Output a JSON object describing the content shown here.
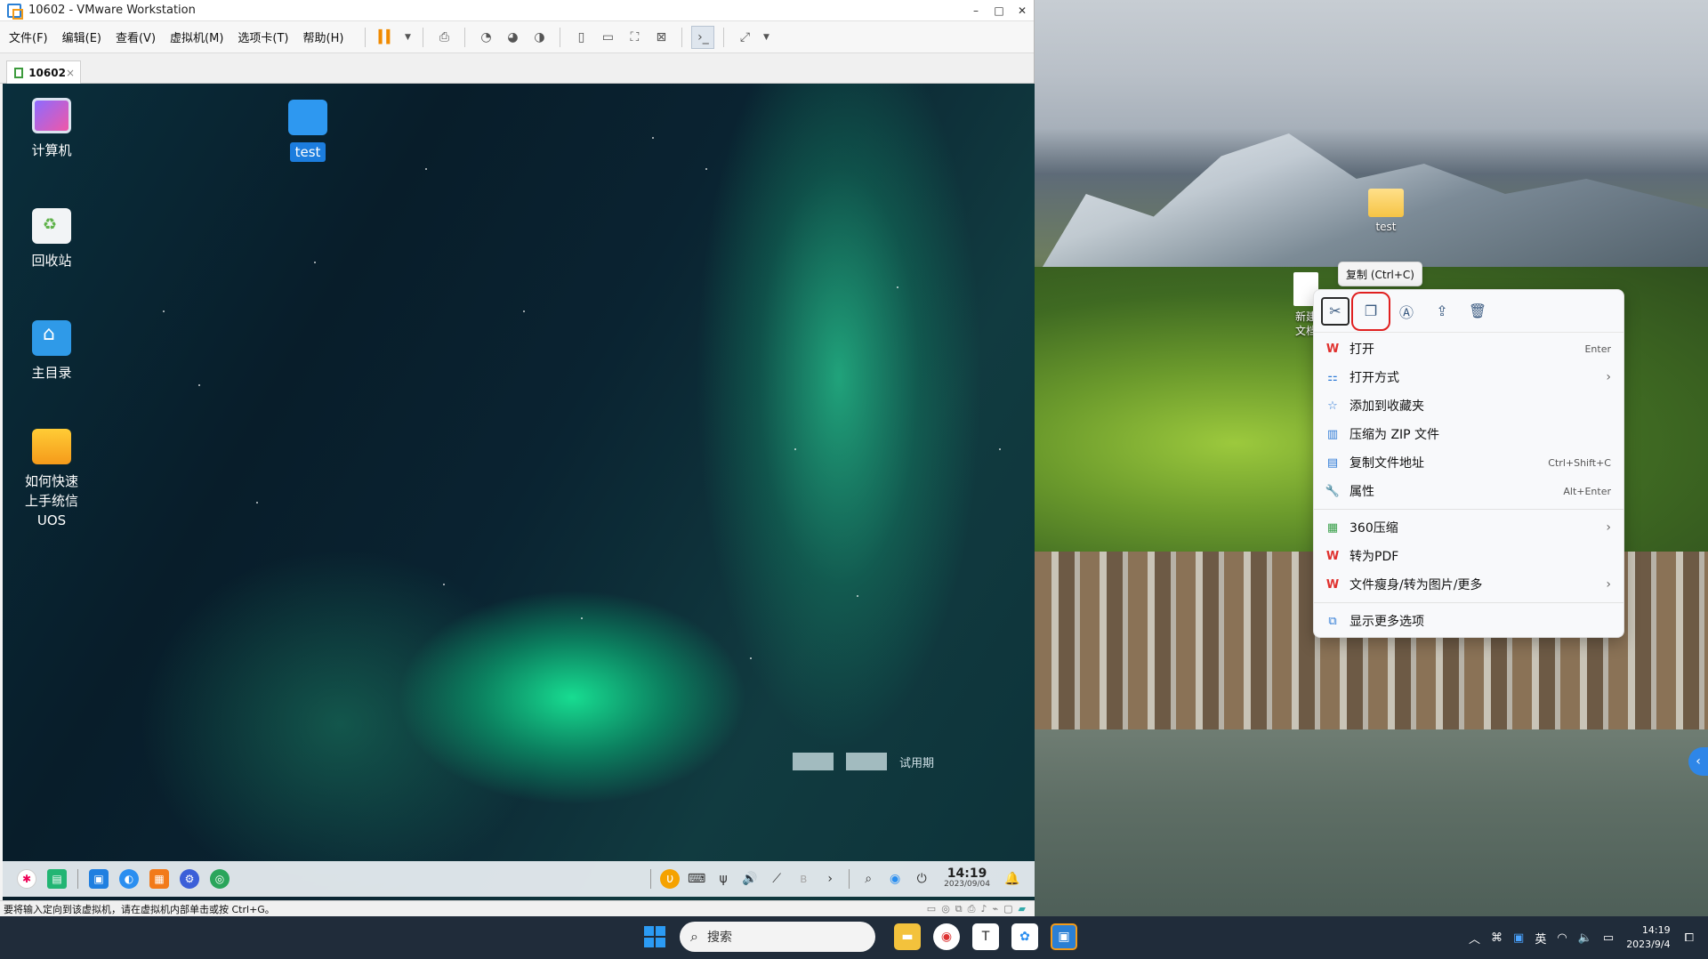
{
  "vm_window": {
    "title": "10602 - VMware Workstation",
    "window_controls": {
      "minimize": "–",
      "maximize": "□",
      "close": "✕"
    },
    "menu": [
      "文件(F)",
      "编辑(E)",
      "查看(V)",
      "虚拟机(M)",
      "选项卡(T)",
      "帮助(H)"
    ],
    "tab": {
      "label": "10602",
      "close": "×"
    },
    "status_text": "要将输入定向到该虚拟机，请在虚拟机内部单击或按 Ctrl+G。"
  },
  "guest": {
    "desktop_icons": [
      {
        "label": "计算机",
        "icon": "computer-icon"
      },
      {
        "label": "回收站",
        "icon": "trash-icon"
      },
      {
        "label": "主目录",
        "icon": "home-folder-icon"
      },
      {
        "label": "如何快速上手统信UOS",
        "icon": "uos-guide-icon"
      },
      {
        "label": "test",
        "icon": "folder-icon",
        "selected": true
      }
    ],
    "trial_text": "试用期",
    "taskbar": {
      "clock_time": "14:19",
      "clock_date": "2023/09/04"
    }
  },
  "host": {
    "desktop_icons": [
      {
        "label": "test",
        "icon": "folder-icon"
      },
      {
        "label": "新建文档",
        "icon": "document-icon"
      }
    ],
    "tooltip": "复制 (Ctrl+C)",
    "context_menu": {
      "toolbar": [
        {
          "name": "cut",
          "icon": "cut-icon",
          "glyph": "✂"
        },
        {
          "name": "copy",
          "icon": "copy-icon",
          "glyph": "❐"
        },
        {
          "name": "rename",
          "icon": "rename-icon",
          "glyph": "Ⓐ"
        },
        {
          "name": "share",
          "icon": "share-icon",
          "glyph": "⇪"
        },
        {
          "name": "delete",
          "icon": "delete-icon",
          "glyph": "🗑"
        }
      ],
      "items": [
        {
          "label": "打开",
          "shortcut": "Enter",
          "icon": "wps-icon"
        },
        {
          "label": "打开方式",
          "submenu": true,
          "icon": "open-with-icon"
        },
        {
          "label": "添加到收藏夹",
          "icon": "star-icon"
        },
        {
          "label": "压缩为 ZIP 文件",
          "icon": "zip-icon"
        },
        {
          "label": "复制文件地址",
          "shortcut": "Ctrl+Shift+C",
          "icon": "path-icon"
        },
        {
          "label": "属性",
          "shortcut": "Alt+Enter",
          "icon": "wrench-icon"
        },
        {
          "label": "360压缩",
          "submenu": true,
          "icon": "compress-360-icon"
        },
        {
          "label": "转为PDF",
          "icon": "wps-icon"
        },
        {
          "label": "文件瘦身/转为图片/更多",
          "submenu": true,
          "icon": "wps-icon"
        },
        {
          "label": "显示更多选项",
          "icon": "more-options-icon"
        }
      ]
    },
    "taskbar": {
      "search_placeholder": "搜索",
      "ime": "英",
      "clock_time": "14:19",
      "clock_date": "2023/9/4"
    }
  }
}
